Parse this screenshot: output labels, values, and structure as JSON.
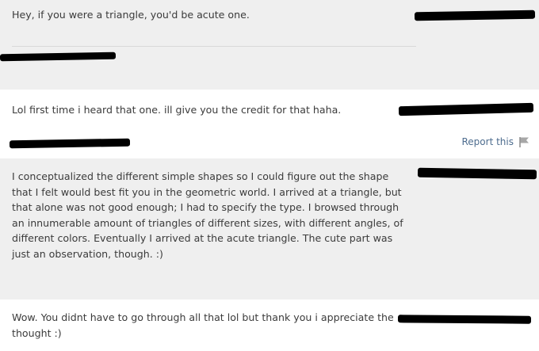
{
  "messages": [
    {
      "text": "Hey, if you were a triangle, you'd be acute one."
    },
    {
      "text": "Lol first time i heard that one. ill give you the credit for that haha.",
      "report_label": "Report this"
    },
    {
      "text": "I conceptualized the different simple shapes so I could figure out the shape that I felt would best fit you in the geometric world. I arrived at a triangle, but that alone was not good enough; I had to specify the type. I browsed through an innumerable amount of triangles of different sizes, with different angles, of different colors. Eventually I arrived at the acute triangle. The cute part was just an observation, though. :)"
    },
    {
      "text": "Wow. You didnt have to go through all that lol but thank you i appreciate the thought :)"
    }
  ],
  "icons": {
    "report": "flag-icon"
  },
  "colors": {
    "gray_bg": "#efefef",
    "link": "#4e6d8f",
    "text": "#3b3b3b"
  }
}
